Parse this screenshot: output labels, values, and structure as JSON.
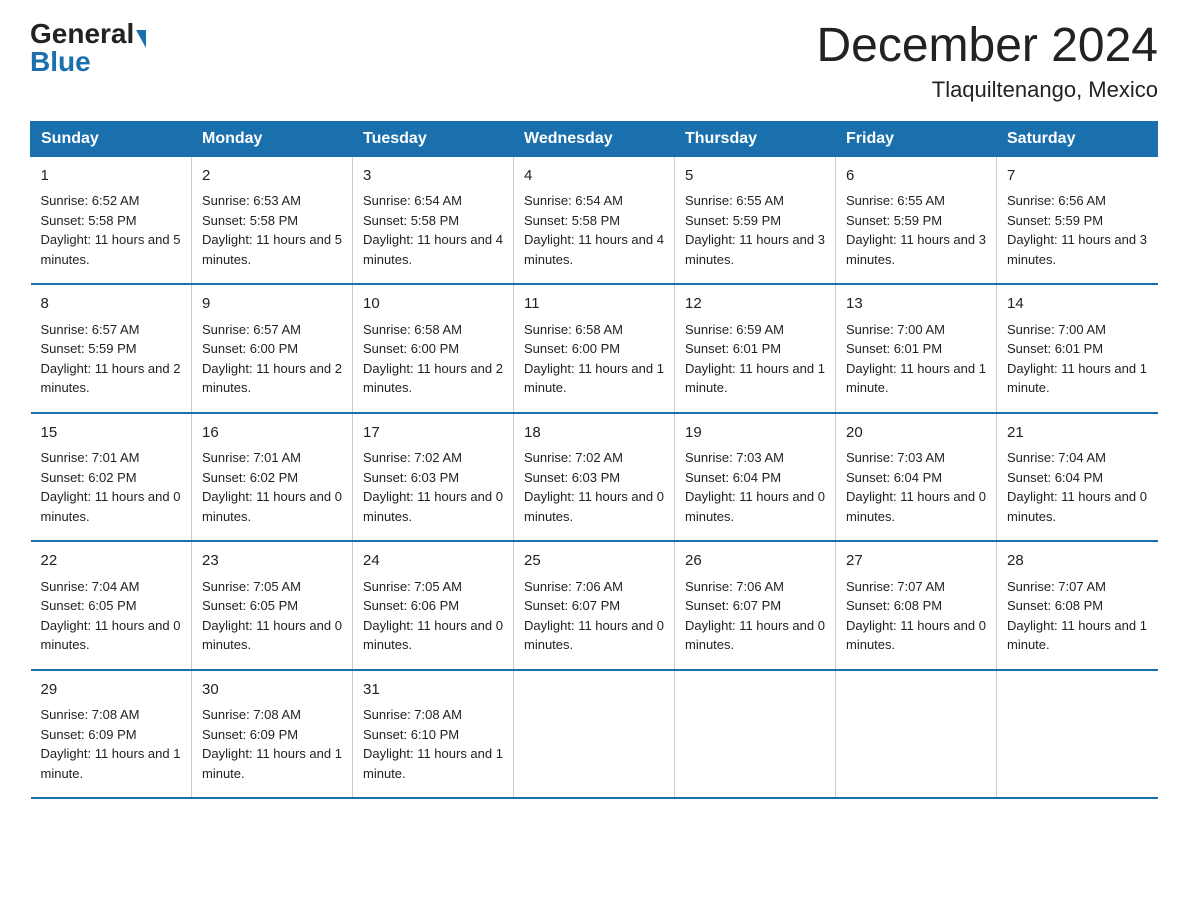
{
  "header": {
    "logo_general": "General",
    "logo_blue": "Blue",
    "month_title": "December 2024",
    "location": "Tlaquiltenango, Mexico"
  },
  "days_of_week": [
    "Sunday",
    "Monday",
    "Tuesday",
    "Wednesday",
    "Thursday",
    "Friday",
    "Saturday"
  ],
  "weeks": [
    [
      {
        "day": "1",
        "sunrise": "6:52 AM",
        "sunset": "5:58 PM",
        "daylight": "11 hours and 5 minutes."
      },
      {
        "day": "2",
        "sunrise": "6:53 AM",
        "sunset": "5:58 PM",
        "daylight": "11 hours and 5 minutes."
      },
      {
        "day": "3",
        "sunrise": "6:54 AM",
        "sunset": "5:58 PM",
        "daylight": "11 hours and 4 minutes."
      },
      {
        "day": "4",
        "sunrise": "6:54 AM",
        "sunset": "5:58 PM",
        "daylight": "11 hours and 4 minutes."
      },
      {
        "day": "5",
        "sunrise": "6:55 AM",
        "sunset": "5:59 PM",
        "daylight": "11 hours and 3 minutes."
      },
      {
        "day": "6",
        "sunrise": "6:55 AM",
        "sunset": "5:59 PM",
        "daylight": "11 hours and 3 minutes."
      },
      {
        "day": "7",
        "sunrise": "6:56 AM",
        "sunset": "5:59 PM",
        "daylight": "11 hours and 3 minutes."
      }
    ],
    [
      {
        "day": "8",
        "sunrise": "6:57 AM",
        "sunset": "5:59 PM",
        "daylight": "11 hours and 2 minutes."
      },
      {
        "day": "9",
        "sunrise": "6:57 AM",
        "sunset": "6:00 PM",
        "daylight": "11 hours and 2 minutes."
      },
      {
        "day": "10",
        "sunrise": "6:58 AM",
        "sunset": "6:00 PM",
        "daylight": "11 hours and 2 minutes."
      },
      {
        "day": "11",
        "sunrise": "6:58 AM",
        "sunset": "6:00 PM",
        "daylight": "11 hours and 1 minute."
      },
      {
        "day": "12",
        "sunrise": "6:59 AM",
        "sunset": "6:01 PM",
        "daylight": "11 hours and 1 minute."
      },
      {
        "day": "13",
        "sunrise": "7:00 AM",
        "sunset": "6:01 PM",
        "daylight": "11 hours and 1 minute."
      },
      {
        "day": "14",
        "sunrise": "7:00 AM",
        "sunset": "6:01 PM",
        "daylight": "11 hours and 1 minute."
      }
    ],
    [
      {
        "day": "15",
        "sunrise": "7:01 AM",
        "sunset": "6:02 PM",
        "daylight": "11 hours and 0 minutes."
      },
      {
        "day": "16",
        "sunrise": "7:01 AM",
        "sunset": "6:02 PM",
        "daylight": "11 hours and 0 minutes."
      },
      {
        "day": "17",
        "sunrise": "7:02 AM",
        "sunset": "6:03 PM",
        "daylight": "11 hours and 0 minutes."
      },
      {
        "day": "18",
        "sunrise": "7:02 AM",
        "sunset": "6:03 PM",
        "daylight": "11 hours and 0 minutes."
      },
      {
        "day": "19",
        "sunrise": "7:03 AM",
        "sunset": "6:04 PM",
        "daylight": "11 hours and 0 minutes."
      },
      {
        "day": "20",
        "sunrise": "7:03 AM",
        "sunset": "6:04 PM",
        "daylight": "11 hours and 0 minutes."
      },
      {
        "day": "21",
        "sunrise": "7:04 AM",
        "sunset": "6:04 PM",
        "daylight": "11 hours and 0 minutes."
      }
    ],
    [
      {
        "day": "22",
        "sunrise": "7:04 AM",
        "sunset": "6:05 PM",
        "daylight": "11 hours and 0 minutes."
      },
      {
        "day": "23",
        "sunrise": "7:05 AM",
        "sunset": "6:05 PM",
        "daylight": "11 hours and 0 minutes."
      },
      {
        "day": "24",
        "sunrise": "7:05 AM",
        "sunset": "6:06 PM",
        "daylight": "11 hours and 0 minutes."
      },
      {
        "day": "25",
        "sunrise": "7:06 AM",
        "sunset": "6:07 PM",
        "daylight": "11 hours and 0 minutes."
      },
      {
        "day": "26",
        "sunrise": "7:06 AM",
        "sunset": "6:07 PM",
        "daylight": "11 hours and 0 minutes."
      },
      {
        "day": "27",
        "sunrise": "7:07 AM",
        "sunset": "6:08 PM",
        "daylight": "11 hours and 0 minutes."
      },
      {
        "day": "28",
        "sunrise": "7:07 AM",
        "sunset": "6:08 PM",
        "daylight": "11 hours and 1 minute."
      }
    ],
    [
      {
        "day": "29",
        "sunrise": "7:08 AM",
        "sunset": "6:09 PM",
        "daylight": "11 hours and 1 minute."
      },
      {
        "day": "30",
        "sunrise": "7:08 AM",
        "sunset": "6:09 PM",
        "daylight": "11 hours and 1 minute."
      },
      {
        "day": "31",
        "sunrise": "7:08 AM",
        "sunset": "6:10 PM",
        "daylight": "11 hours and 1 minute."
      },
      null,
      null,
      null,
      null
    ]
  ],
  "labels": {
    "sunrise": "Sunrise:",
    "sunset": "Sunset:",
    "daylight": "Daylight:"
  }
}
